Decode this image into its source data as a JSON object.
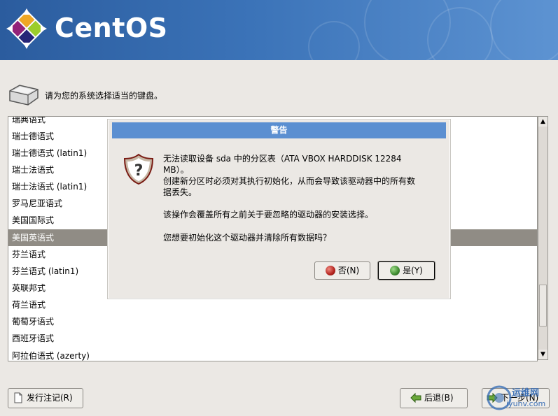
{
  "banner": {
    "logo_text": "CentOS"
  },
  "prompt": "请为您的系统选择适当的键盘。",
  "list": {
    "items": [
      {
        "label": "瑞典语式",
        "selected": false
      },
      {
        "label": "瑞士德语式",
        "selected": false
      },
      {
        "label": "瑞士德语式 (latin1)",
        "selected": false
      },
      {
        "label": "瑞士法语式",
        "selected": false
      },
      {
        "label": "瑞士法语式 (latin1)",
        "selected": false
      },
      {
        "label": "罗马尼亚语式",
        "selected": false
      },
      {
        "label": "美国国际式",
        "selected": false
      },
      {
        "label": "美国英语式",
        "selected": true
      },
      {
        "label": "芬兰语式",
        "selected": false
      },
      {
        "label": "芬兰语式 (latin1)",
        "selected": false
      },
      {
        "label": "英联邦式",
        "selected": false
      },
      {
        "label": "荷兰语式",
        "selected": false
      },
      {
        "label": "葡萄牙语式",
        "selected": false
      },
      {
        "label": "西班牙语式",
        "selected": false
      },
      {
        "label": "阿拉伯语式 (azerty)",
        "selected": false
      }
    ]
  },
  "dialog": {
    "title": "警告",
    "message_line1": "无法读取设备 sda 中的分区表（ATA VBOX HARDDISK 12284",
    "message_line2": "MB）。",
    "message_line3": "创建新分区时必须对其执行初始化，从而会导致该驱动器中的所有数",
    "message_line4": "据丢失。",
    "message_para2": "该操作会覆盖所有之前关于要忽略的驱动器的安装选择。",
    "message_para3": "您想要初始化这个驱动器并清除所有数据吗？",
    "no_label": "否(N)",
    "yes_label": "是(Y)"
  },
  "footer": {
    "release_notes_label": "发行注记(R)",
    "back_label": "后退(B)",
    "next_label": "下一步(N)"
  },
  "watermark": {
    "line1": "运维网",
    "line2": "iyunv.com"
  },
  "colors": {
    "dialog_title_bg": "#5b8fd1",
    "selected_row_bg": "#908c85",
    "no_dot": "#b3231e",
    "yes_dot": "#3d8a2f"
  }
}
